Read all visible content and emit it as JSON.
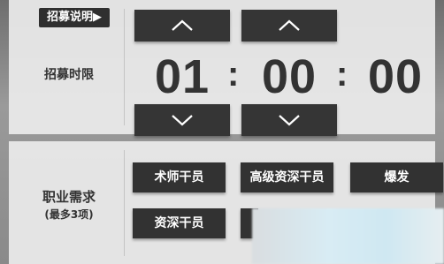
{
  "recruit_info_tag": "招募说明▶",
  "time_limit": {
    "label": "招募时限",
    "hours": "01",
    "minutes": "00",
    "seconds": "00",
    "colon": ":"
  },
  "jobs": {
    "label": "职业需求",
    "sublabel": "(最多3项)",
    "buttons": [
      "术师干员",
      "高级资深干员",
      "爆发",
      "资深干员"
    ]
  },
  "colors": {
    "button_bg": "#353535",
    "panel_bg": "#ebebeb",
    "text_dark": "#333333"
  }
}
